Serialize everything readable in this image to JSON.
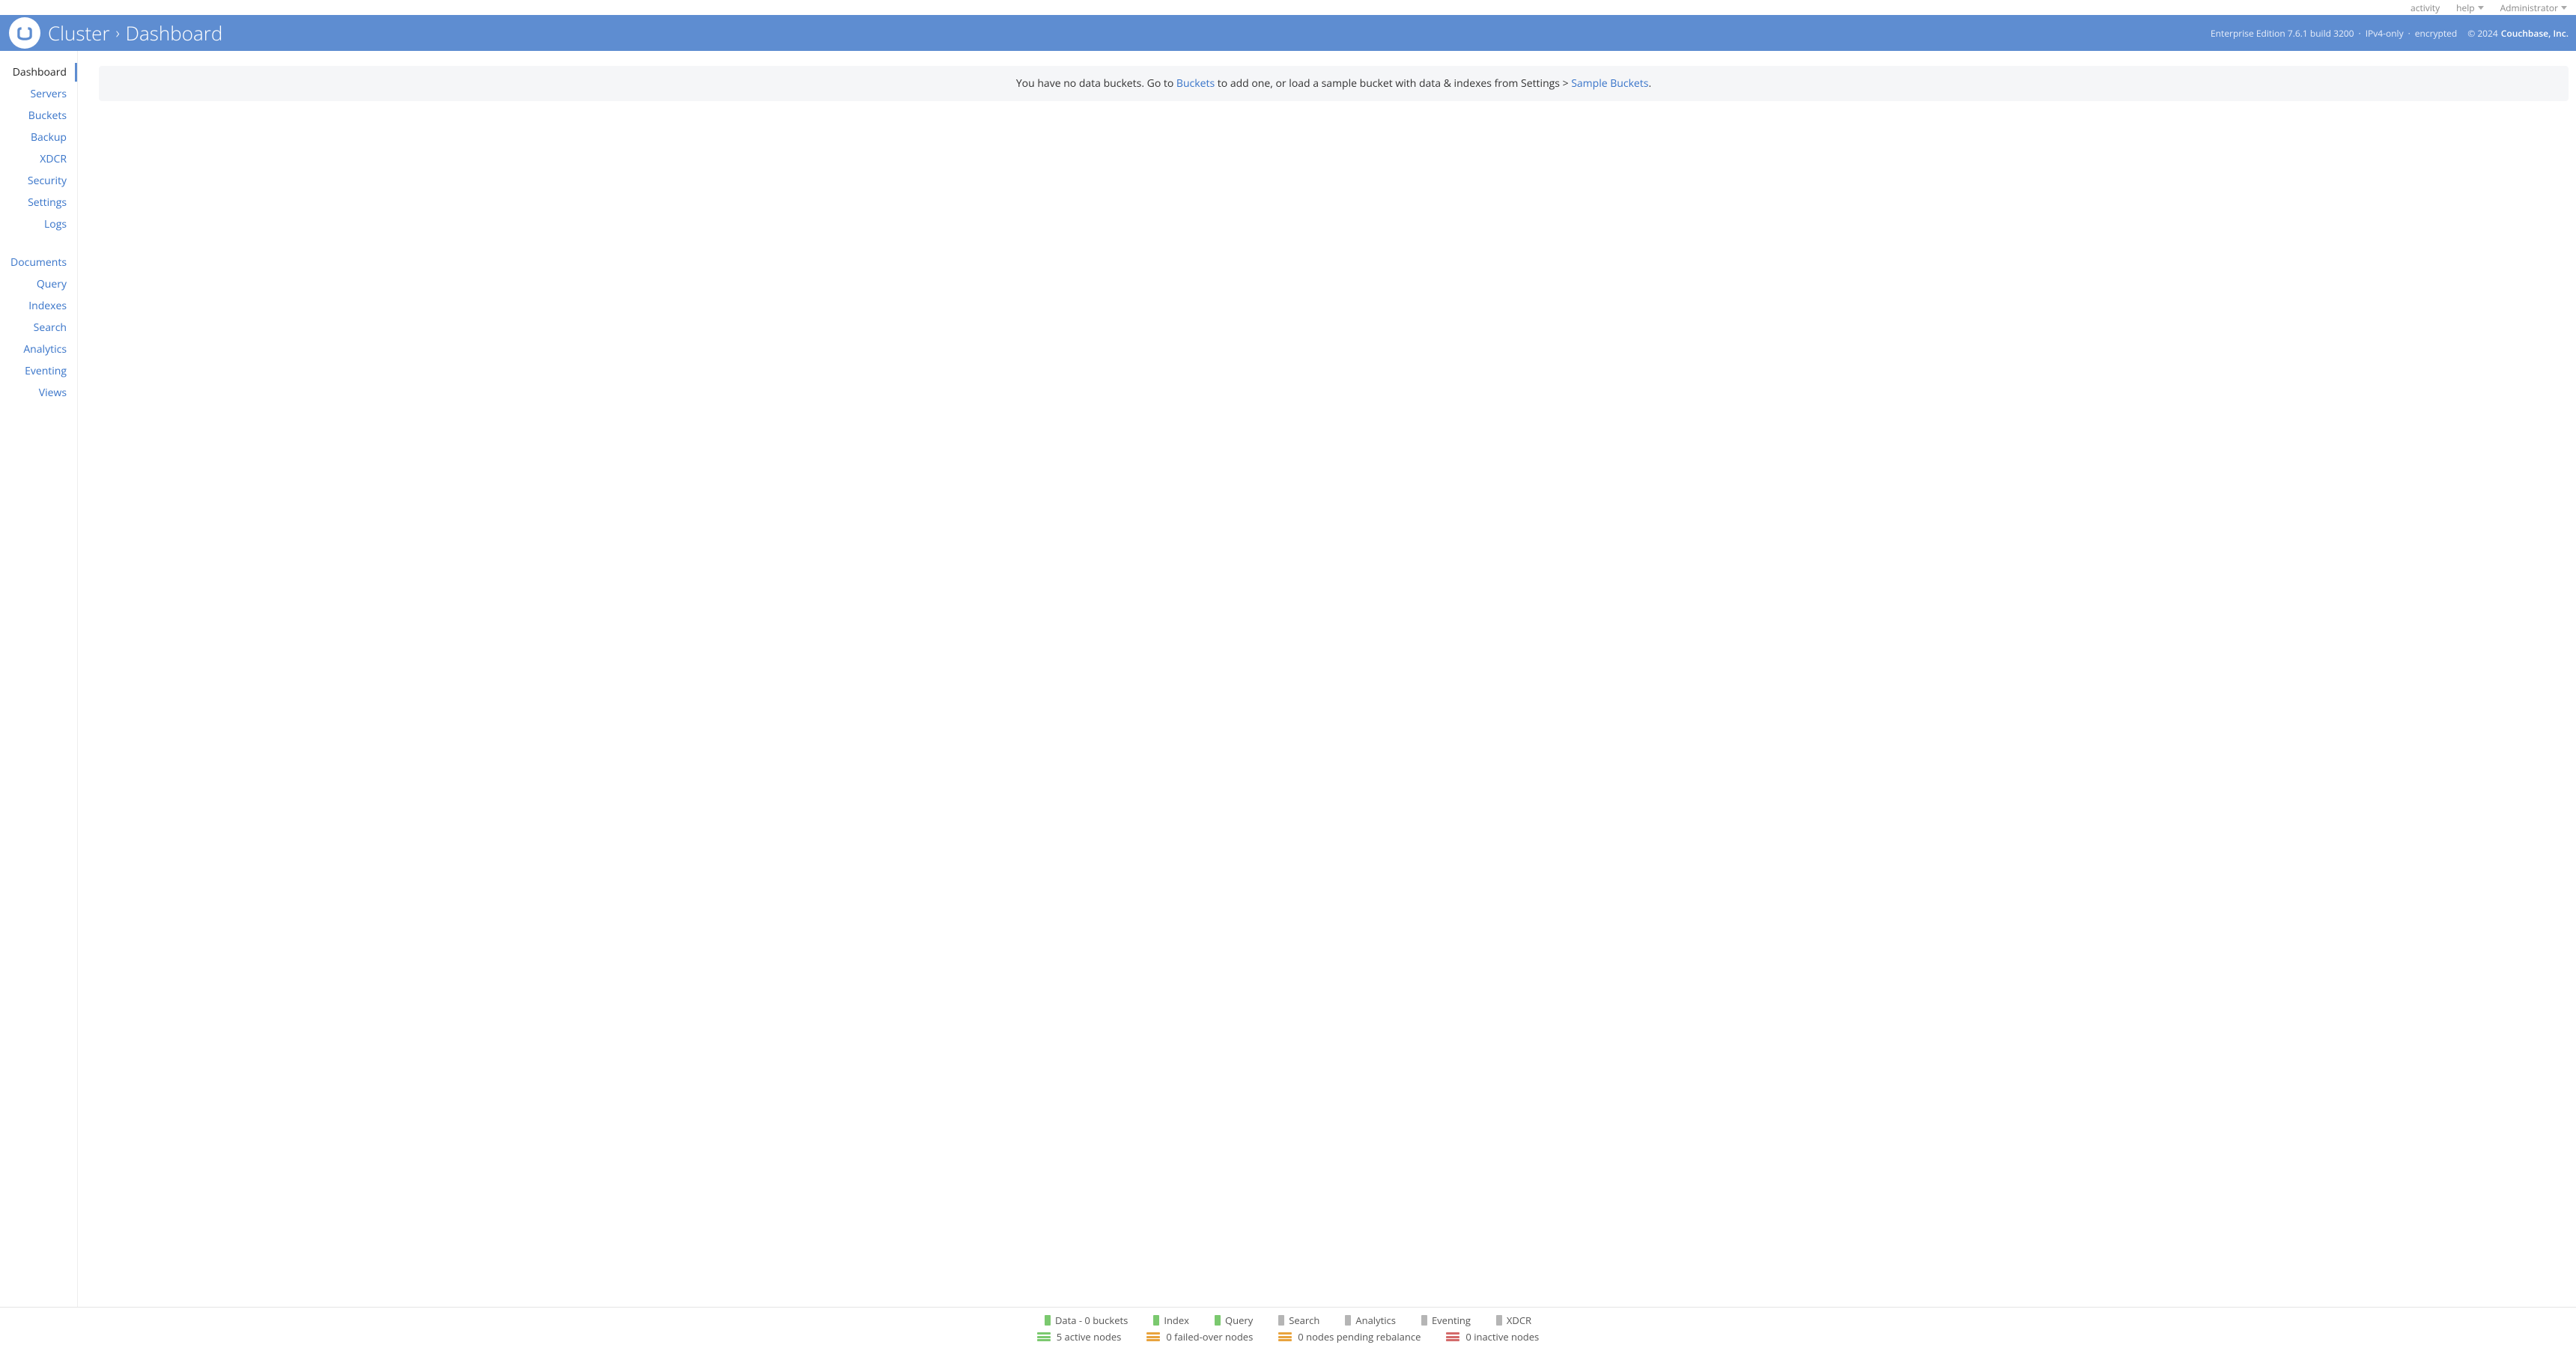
{
  "topbar": {
    "activity": "activity",
    "help": "help",
    "user": "Administrator"
  },
  "header": {
    "cluster": "Cluster",
    "page": "Dashboard",
    "edition": "Enterprise Edition 7.6.1 build 3200",
    "ip_mode": "IPv4-only",
    "encryption": "encrypted",
    "copyright": "© 2024",
    "company": "Couchbase, Inc."
  },
  "sidebar": {
    "group1": [
      {
        "label": "Dashboard",
        "active": true
      },
      {
        "label": "Servers"
      },
      {
        "label": "Buckets"
      },
      {
        "label": "Backup"
      },
      {
        "label": "XDCR"
      },
      {
        "label": "Security"
      },
      {
        "label": "Settings"
      },
      {
        "label": "Logs"
      }
    ],
    "group2": [
      {
        "label": "Documents"
      },
      {
        "label": "Query"
      },
      {
        "label": "Indexes"
      },
      {
        "label": "Search"
      },
      {
        "label": "Analytics"
      },
      {
        "label": "Eventing"
      },
      {
        "label": "Views"
      }
    ]
  },
  "notice": {
    "pre": "You have no data buckets. Go to ",
    "link1": "Buckets",
    "mid": " to add one, or load a sample bucket with data & indexes from Settings > ",
    "link2": "Sample Buckets",
    "post": "."
  },
  "footer": {
    "services": [
      {
        "label": "Data - 0 buckets",
        "status": "green"
      },
      {
        "label": "Index",
        "status": "green"
      },
      {
        "label": "Query",
        "status": "green"
      },
      {
        "label": "Search",
        "status": "gray"
      },
      {
        "label": "Analytics",
        "status": "gray"
      },
      {
        "label": "Eventing",
        "status": "gray"
      },
      {
        "label": "XDCR",
        "status": "gray"
      }
    ],
    "nodes": [
      {
        "label": "5 active nodes",
        "color": "green"
      },
      {
        "label": "0 failed-over nodes",
        "color": "orange"
      },
      {
        "label": "0 nodes pending rebalance",
        "color": "orange"
      },
      {
        "label": "0 inactive nodes",
        "color": "red"
      }
    ]
  }
}
